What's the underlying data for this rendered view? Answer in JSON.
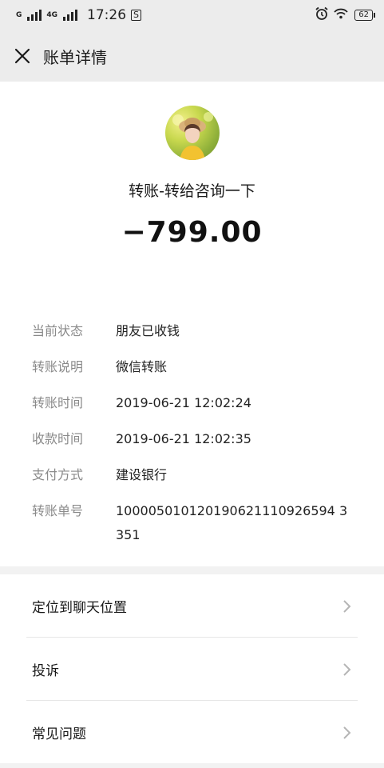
{
  "status_bar": {
    "carrier_label": "G",
    "network_label": "4G",
    "time": "17:26",
    "notification_icon": "message-icon",
    "battery": "62",
    "icons": [
      "signal-icon",
      "alarm-icon",
      "wifi-icon",
      "battery-icon"
    ]
  },
  "nav": {
    "title": "账单详情",
    "close_icon": "close-icon"
  },
  "transaction": {
    "subject": "转账-转给咨询一下",
    "amount": "−799.00"
  },
  "details": [
    {
      "label": "当前状态",
      "value": "朋友已收钱"
    },
    {
      "label": "转账说明",
      "value": "微信转账"
    },
    {
      "label": "转账时间",
      "value": "2019-06-21 12:02:24"
    },
    {
      "label": "收款时间",
      "value": "2019-06-21 12:02:35"
    },
    {
      "label": "支付方式",
      "value": "建设银行"
    },
    {
      "label": "转账单号",
      "value": "100005010120190621110926594 3351"
    }
  ],
  "menu": [
    {
      "label": "定位到聊天位置"
    },
    {
      "label": "投诉"
    },
    {
      "label": "常见问题"
    }
  ]
}
